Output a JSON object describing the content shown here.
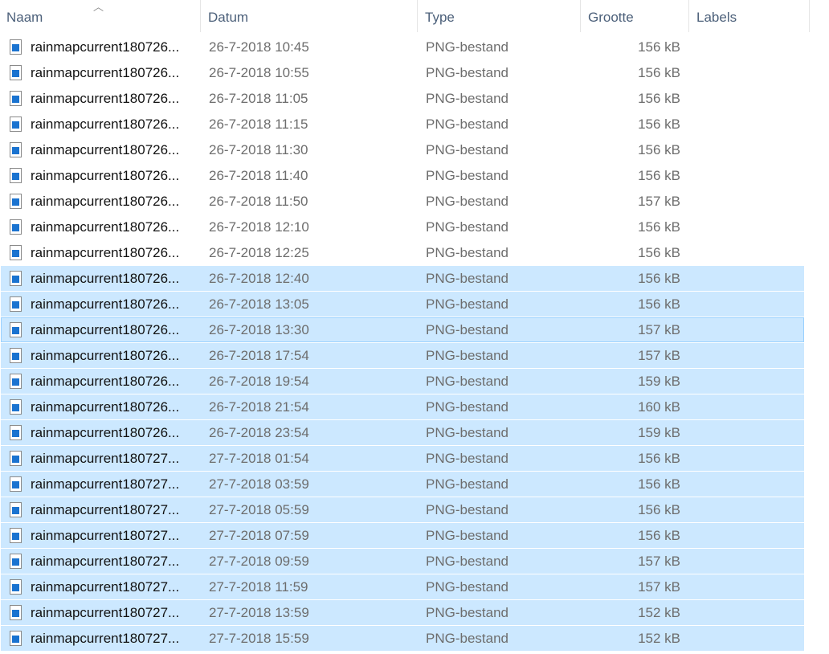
{
  "columns": {
    "name": "Naam",
    "date": "Datum",
    "type": "Type",
    "size": "Grootte",
    "labels": "Labels"
  },
  "files": [
    {
      "name": "rainmapcurrent180726...",
      "date": "26-7-2018 10:45",
      "type": "PNG-bestand",
      "size": "156 kB",
      "selected": false
    },
    {
      "name": "rainmapcurrent180726...",
      "date": "26-7-2018 10:55",
      "type": "PNG-bestand",
      "size": "156 kB",
      "selected": false
    },
    {
      "name": "rainmapcurrent180726...",
      "date": "26-7-2018 11:05",
      "type": "PNG-bestand",
      "size": "156 kB",
      "selected": false
    },
    {
      "name": "rainmapcurrent180726...",
      "date": "26-7-2018 11:15",
      "type": "PNG-bestand",
      "size": "156 kB",
      "selected": false
    },
    {
      "name": "rainmapcurrent180726...",
      "date": "26-7-2018 11:30",
      "type": "PNG-bestand",
      "size": "156 kB",
      "selected": false
    },
    {
      "name": "rainmapcurrent180726...",
      "date": "26-7-2018 11:40",
      "type": "PNG-bestand",
      "size": "156 kB",
      "selected": false
    },
    {
      "name": "rainmapcurrent180726...",
      "date": "26-7-2018 11:50",
      "type": "PNG-bestand",
      "size": "157 kB",
      "selected": false
    },
    {
      "name": "rainmapcurrent180726...",
      "date": "26-7-2018 12:10",
      "type": "PNG-bestand",
      "size": "156 kB",
      "selected": false
    },
    {
      "name": "rainmapcurrent180726...",
      "date": "26-7-2018 12:25",
      "type": "PNG-bestand",
      "size": "156 kB",
      "selected": false
    },
    {
      "name": "rainmapcurrent180726...",
      "date": "26-7-2018 12:40",
      "type": "PNG-bestand",
      "size": "156 kB",
      "selected": true
    },
    {
      "name": "rainmapcurrent180726...",
      "date": "26-7-2018 13:05",
      "type": "PNG-bestand",
      "size": "156 kB",
      "selected": true
    },
    {
      "name": "rainmapcurrent180726...",
      "date": "26-7-2018 13:30",
      "type": "PNG-bestand",
      "size": "157 kB",
      "selected": true,
      "focused": true
    },
    {
      "name": "rainmapcurrent180726...",
      "date": "26-7-2018 17:54",
      "type": "PNG-bestand",
      "size": "157 kB",
      "selected": true
    },
    {
      "name": "rainmapcurrent180726...",
      "date": "26-7-2018 19:54",
      "type": "PNG-bestand",
      "size": "159 kB",
      "selected": true
    },
    {
      "name": "rainmapcurrent180726...",
      "date": "26-7-2018 21:54",
      "type": "PNG-bestand",
      "size": "160 kB",
      "selected": true
    },
    {
      "name": "rainmapcurrent180726...",
      "date": "26-7-2018 23:54",
      "type": "PNG-bestand",
      "size": "159 kB",
      "selected": true
    },
    {
      "name": "rainmapcurrent180727...",
      "date": "27-7-2018 01:54",
      "type": "PNG-bestand",
      "size": "156 kB",
      "selected": true
    },
    {
      "name": "rainmapcurrent180727...",
      "date": "27-7-2018 03:59",
      "type": "PNG-bestand",
      "size": "156 kB",
      "selected": true
    },
    {
      "name": "rainmapcurrent180727...",
      "date": "27-7-2018 05:59",
      "type": "PNG-bestand",
      "size": "156 kB",
      "selected": true
    },
    {
      "name": "rainmapcurrent180727...",
      "date": "27-7-2018 07:59",
      "type": "PNG-bestand",
      "size": "156 kB",
      "selected": true
    },
    {
      "name": "rainmapcurrent180727...",
      "date": "27-7-2018 09:59",
      "type": "PNG-bestand",
      "size": "157 kB",
      "selected": true
    },
    {
      "name": "rainmapcurrent180727...",
      "date": "27-7-2018 11:59",
      "type": "PNG-bestand",
      "size": "157 kB",
      "selected": true
    },
    {
      "name": "rainmapcurrent180727...",
      "date": "27-7-2018 13:59",
      "type": "PNG-bestand",
      "size": "152 kB",
      "selected": true
    },
    {
      "name": "rainmapcurrent180727...",
      "date": "27-7-2018 15:59",
      "type": "PNG-bestand",
      "size": "152 kB",
      "selected": true
    }
  ]
}
